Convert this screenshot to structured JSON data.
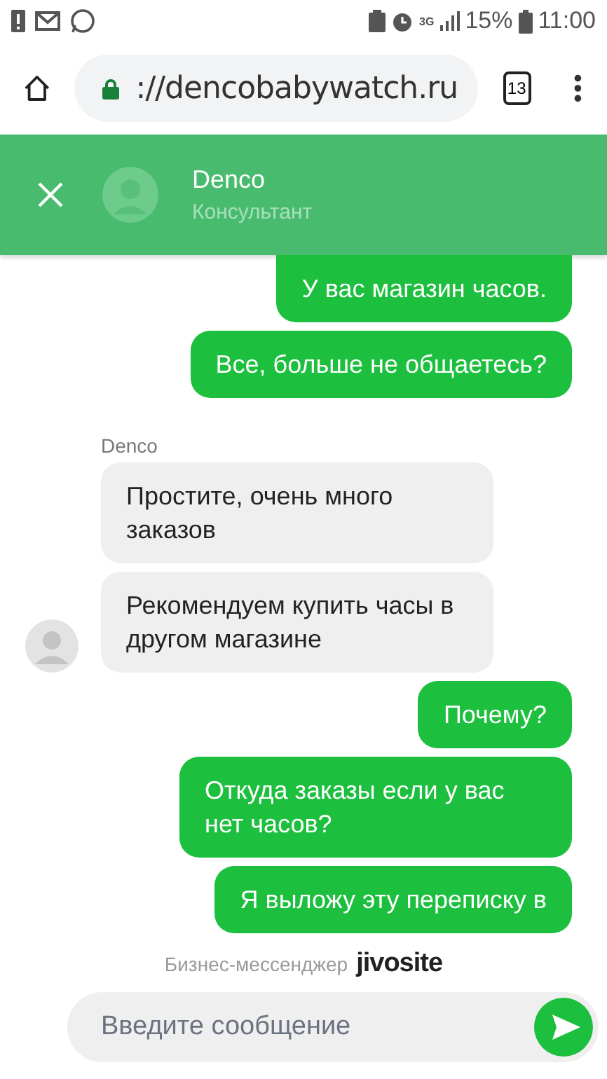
{
  "status_bar": {
    "network": "3G",
    "battery": "15%",
    "time": "11:00"
  },
  "browser": {
    "url": "://dencobabywatch.ru",
    "tab_count": "13"
  },
  "chat_header": {
    "name": "Denco",
    "role": "Консультант"
  },
  "messages": [
    {
      "kind": "sent",
      "text": "У вас магазин часов."
    },
    {
      "kind": "sent",
      "text": "Все, больше не общаетесь?"
    },
    {
      "kind": "received",
      "sender": "Denco",
      "text": "Простите, очень много заказов"
    },
    {
      "kind": "received",
      "text": "Рекомендуем купить часы в другом магазине",
      "avatar": true
    },
    {
      "kind": "sent",
      "text": "Почему?"
    },
    {
      "kind": "sent",
      "text": "Откуда заказы если у вас нет часов?"
    },
    {
      "kind": "sent",
      "text": "Я выложу эту переписку в"
    }
  ],
  "branding": {
    "label": "Бизнес-мессенджер",
    "logo": "jivosite"
  },
  "composer": {
    "placeholder": "Введите сообщение"
  }
}
